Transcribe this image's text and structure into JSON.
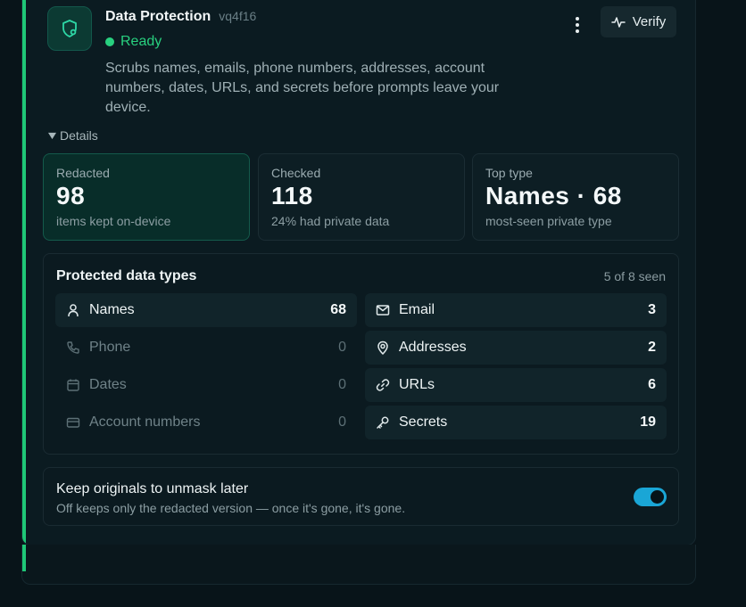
{
  "plugin": {
    "title": "Data Protection",
    "version": "vq4f16",
    "status": "Ready",
    "description": "Scrubs names, emails, phone numbers, addresses, account numbers, dates, URLs, and secrets before prompts leave your device.",
    "verify_label": "Verify",
    "details_label": "Details",
    "accent_color": "#1fc777",
    "status_color": "#28d07f"
  },
  "stats": [
    {
      "label": "Redacted",
      "value": "98",
      "sub": "items kept on-device"
    },
    {
      "label": "Checked",
      "value": "118",
      "sub": "24% had private data"
    },
    {
      "label": "Top type",
      "value": "Names · 68",
      "sub": "most-seen private type"
    }
  ],
  "types": {
    "title": "Protected data types",
    "count_label": "5 of 8 seen",
    "left": [
      {
        "name": "Names",
        "value": "68",
        "icon": "person-icon"
      },
      {
        "name": "Phone",
        "value": "0",
        "icon": "phone-icon"
      },
      {
        "name": "Dates",
        "value": "0",
        "icon": "calendar-icon"
      },
      {
        "name": "Account numbers",
        "value": "0",
        "icon": "credit-card-icon"
      }
    ],
    "right": [
      {
        "name": "Email",
        "value": "3",
        "icon": "mail-icon"
      },
      {
        "name": "Addresses",
        "value": "2",
        "icon": "map-pin-icon"
      },
      {
        "name": "URLs",
        "value": "6",
        "icon": "link-icon"
      },
      {
        "name": "Secrets",
        "value": "19",
        "icon": "key-icon"
      }
    ]
  },
  "keep_originals": {
    "title": "Keep originals to unmask later",
    "subtitle": "Off keeps only the redacted version — once it's gone, it's gone.",
    "enabled": true,
    "toggle_color": "#1aa6d6"
  }
}
